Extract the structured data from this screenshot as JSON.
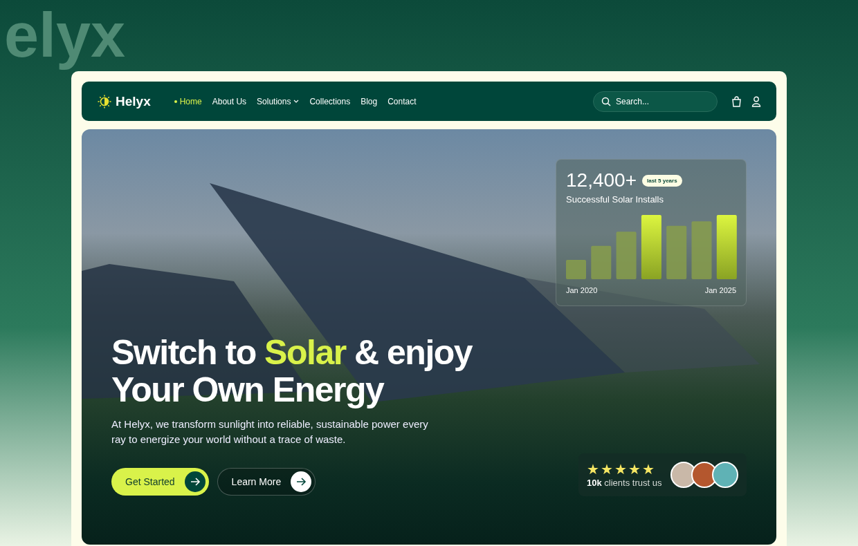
{
  "backdrop": {
    "wordmark": "elyx"
  },
  "nav": {
    "logo": "Helyx",
    "links": [
      {
        "label": "Home",
        "selected": true,
        "dropdown": false
      },
      {
        "label": "About Us",
        "selected": false,
        "dropdown": false
      },
      {
        "label": "Solutions",
        "selected": false,
        "dropdown": true
      },
      {
        "label": "Collections",
        "selected": false,
        "dropdown": false
      },
      {
        "label": "Blog",
        "selected": false,
        "dropdown": false
      },
      {
        "label": "Contact",
        "selected": false,
        "dropdown": false
      }
    ],
    "search": {
      "placeholder": "Search..."
    }
  },
  "hero": {
    "headline": [
      {
        "text": "Switch to ",
        "highlight": false
      },
      {
        "text": "Solar",
        "highlight": true
      },
      {
        "text": " & enjoy",
        "highlight": false
      }
    ],
    "headline_line2": "Your Own Energy",
    "description": "At Helyx, we transform sunlight into reliable, sustainable power every ray to energize your world without a trace of waste.",
    "buttons": [
      {
        "label": "Get Started",
        "kind": "primary"
      },
      {
        "label": "Learn More",
        "kind": "secondary"
      }
    ]
  },
  "stats_card": {
    "value": "12,400+",
    "badge": "last 5 years",
    "label": "Successful Solar Installs",
    "start_label": "Jan 2020",
    "end_label": "Jan 2025"
  },
  "trust": {
    "stars": 5,
    "text": "**10k** clients trust us"
  }
}
